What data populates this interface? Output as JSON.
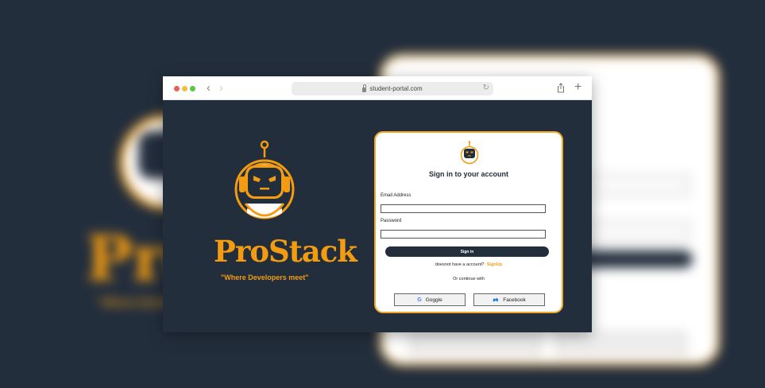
{
  "browser": {
    "url": "student-portal.com",
    "back_icon": "chevron-left-icon",
    "forward_icon": "chevron-right-icon",
    "reload_icon": "reload-icon",
    "share_icon": "share-icon",
    "new_tab_icon": "plus-icon"
  },
  "brand": {
    "name": "ProStack",
    "tagline": "\"Where Developers meet\"",
    "logo_icon": "robot-icon"
  },
  "login": {
    "title": "Sign in to your account",
    "email_label": "Email Address",
    "email_value": "",
    "password_label": "Password",
    "password_value": "",
    "signin_label": "Sign in",
    "signup_prompt": "doesnot have a account?",
    "signup_link": "SignUp",
    "divider_text": "Or continue with",
    "google_label": "Goggle",
    "facebook_label": "Facebook"
  },
  "colors": {
    "background": "#232e3d",
    "accent": "#f39c12",
    "card": "#ffffff"
  }
}
